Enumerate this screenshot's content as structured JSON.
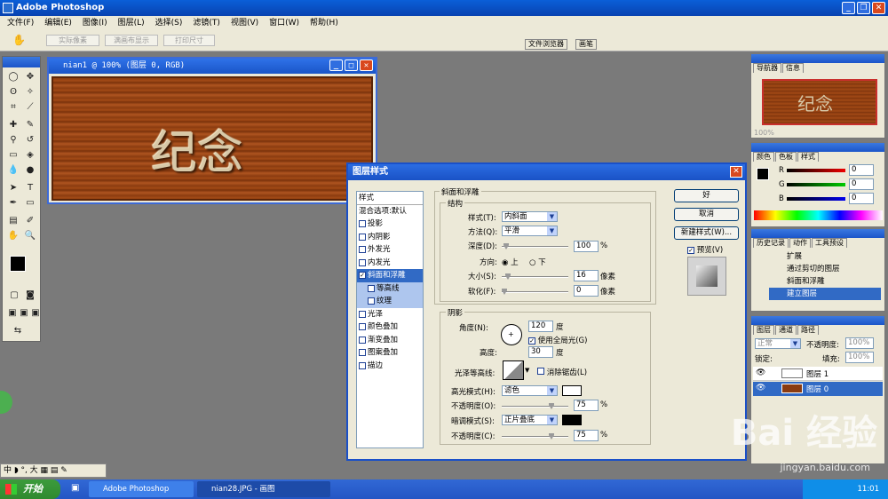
{
  "app": {
    "title": "Adobe Photoshop"
  },
  "menu": [
    "文件(F)",
    "编辑(E)",
    "图像(I)",
    "图层(L)",
    "选择(S)",
    "滤镜(T)",
    "视图(V)",
    "窗口(W)",
    "帮助(H)"
  ],
  "options_bar": {
    "btn1": "实际像素",
    "btn2": "满画布显示",
    "btn3": "打印尺寸",
    "tab_browser": "文件浏览器",
    "tab_brush": "画笔"
  },
  "document": {
    "title": "nian1 @ 100% (图层 0, RGB)",
    "art_text": "纪念"
  },
  "navigator": {
    "tab1": "导航器",
    "tab2": "信息",
    "zoom": "100%",
    "thumb_text": "纪念"
  },
  "color_panel": {
    "tab1": "颜色",
    "tab2": "色板",
    "tab3": "样式",
    "r": "R",
    "g": "G",
    "b": "B",
    "r_val": "0",
    "g_val": "0",
    "b_val": "0"
  },
  "history_panel": {
    "tab1": "历史记录",
    "tab2": "动作",
    "tab3": "工具预设",
    "items": [
      "扩展",
      "通过剪切的图层",
      "斜面和浮雕",
      "建立图层"
    ]
  },
  "layers_panel": {
    "tab1": "图层",
    "tab2": "通道",
    "tab3": "路径",
    "mode": "正常",
    "opacity_label": "不透明度:",
    "opacity": "100%",
    "lock_label": "锁定:",
    "fill_label": "填充:",
    "fill": "100%",
    "layers": [
      "图层 1",
      "图层 0"
    ]
  },
  "dialog": {
    "title": "图层样式",
    "list_header": "样式",
    "list": [
      "混合选项:默认",
      "投影",
      "内阴影",
      "外发光",
      "内发光",
      "斜面和浮雕",
      "等高线",
      "纹理",
      "光泽",
      "颜色叠加",
      "渐变叠加",
      "图案叠加",
      "描边"
    ],
    "section_title": "斜面和浮雕",
    "structure": "结构",
    "style_label": "样式(T):",
    "style_value": "内斜面",
    "method_label": "方法(Q):",
    "method_value": "平滑",
    "depth_label": "深度(D):",
    "depth_value": "100",
    "depth_unit": "%",
    "direction_label": "方向:",
    "dir_up": "上",
    "dir_down": "下",
    "size_label": "大小(S):",
    "size_value": "16",
    "size_unit": "像素",
    "soften_label": "软化(F):",
    "soften_value": "0",
    "soften_unit": "像素",
    "shading": "阴影",
    "angle_label": "角度(N):",
    "angle_value": "120",
    "angle_unit": "度",
    "global_light": "使用全局光(G)",
    "altitude_label": "高度:",
    "altitude_value": "30",
    "altitude_unit": "度",
    "gloss_label": "光泽等高线:",
    "antialias": "消除锯齿(L)",
    "highlight_label": "高光模式(H):",
    "highlight_value": "滤色",
    "hl_opacity_label": "不透明度(O):",
    "hl_opacity_value": "75",
    "hl_opacity_unit": "%",
    "shadow_label": "暗调模式(S):",
    "shadow_value": "正片叠底",
    "sh_opacity_label": "不透明度(C):",
    "sh_opacity_value": "75",
    "sh_opacity_unit": "%",
    "ok": "好",
    "cancel": "取消",
    "new_style": "新建样式(W)...",
    "preview": "预览(V)"
  },
  "ime": "中 ◗ °, 大 ▦ ▤ ✎",
  "taskbar": {
    "start": "开始",
    "task1": "Adobe Photoshop",
    "task2": "nian28.JPG - 画图",
    "clock": "11:01"
  },
  "watermark": {
    "brand": "Bai 经验",
    "url": "jingyan.baidu.com"
  }
}
